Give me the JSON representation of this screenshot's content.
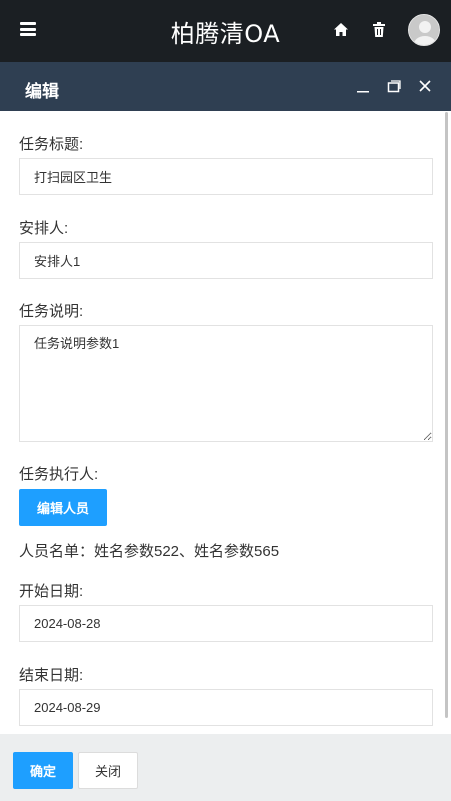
{
  "app": {
    "title": "柏腾清OA"
  },
  "dialog": {
    "title": "编辑"
  },
  "form": {
    "task_title": {
      "label": "任务标题:",
      "value": "打扫园区卫生"
    },
    "arranger": {
      "label": "安排人:",
      "value": "安排人1"
    },
    "description": {
      "label": "任务说明:",
      "value": "任务说明参数1"
    },
    "executor": {
      "label": "任务执行人:",
      "button": "编辑人员",
      "people_list": "人员名单：姓名参数522、姓名参数565"
    },
    "start_date": {
      "label": "开始日期:",
      "value": "2024-08-28"
    },
    "end_date": {
      "label": "结束日期:",
      "value": "2024-08-29"
    }
  },
  "footer": {
    "confirm": "确定",
    "close": "关闭"
  },
  "colors": {
    "topbar": "#1b1f23",
    "dialog_header": "#2f3f52",
    "primary": "#1e9fff",
    "footer": "#eceeef"
  },
  "icons": [
    "menu-icon",
    "home-icon",
    "trash-icon",
    "avatar",
    "minimize-icon",
    "maximize-icon",
    "close-icon"
  ]
}
